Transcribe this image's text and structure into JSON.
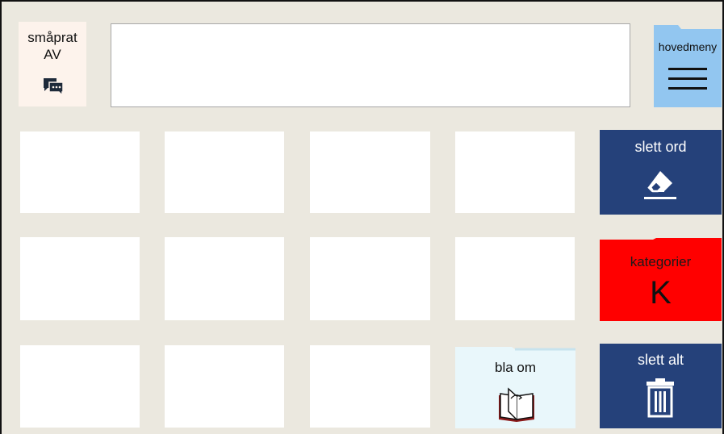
{
  "top": {
    "smaprat": {
      "line1": "småprat",
      "line2": "AV",
      "icon": "chat-bubbles-icon"
    },
    "message_bar": {
      "value": ""
    },
    "hovedmeny": {
      "label": "hovedmeny",
      "icon": "hamburger-menu-icon"
    }
  },
  "actions": {
    "slett_ord": {
      "label": "slett ord",
      "icon": "eraser-icon"
    },
    "kategorier": {
      "label": "kategorier",
      "letter": "K"
    },
    "bla_om": {
      "label": "bla om",
      "icon": "page-turn-book-icon"
    },
    "slett_alt": {
      "label": "slett alt",
      "icon": "trash-can-icon"
    }
  },
  "colors": {
    "background": "#ebe8df",
    "action_blue": "#25417a",
    "kategorier_red": "#ff0000",
    "hovedmeny_blue": "#92c6f0",
    "bla_om_light": "#e9f7fb",
    "smaprat_bg": "#fdf3ec"
  },
  "grid": {
    "rows": 3,
    "columns": 4,
    "empty_cells": 11
  }
}
